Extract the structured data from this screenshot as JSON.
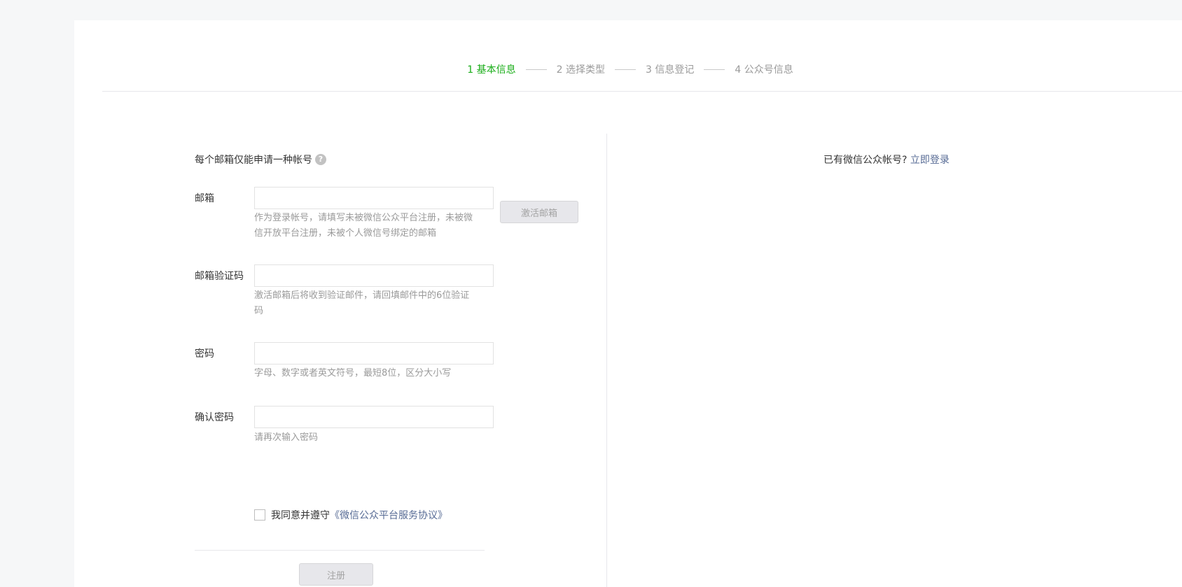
{
  "steps": [
    {
      "label": "1 基本信息"
    },
    {
      "label": "2 选择类型"
    },
    {
      "label": "3 信息登记"
    },
    {
      "label": "4 公众号信息"
    }
  ],
  "form": {
    "tip": "每个邮箱仅能申请一种帐号",
    "email": {
      "label": "邮箱",
      "value": "",
      "placeholder": "",
      "hint": "作为登录帐号，请填写未被微信公众平台注册，未被微信开放平台注册，未被个人微信号绑定的邮箱",
      "activate_label": "激活邮箱"
    },
    "code": {
      "label": "邮箱验证码",
      "value": "",
      "placeholder": "",
      "hint": "激活邮箱后将收到验证邮件，请回填邮件中的6位验证码"
    },
    "password": {
      "label": "密码",
      "value": "",
      "placeholder": "",
      "hint": "字母、数字或者英文符号，最短8位，区分大小写"
    },
    "confirm": {
      "label": "确认密码",
      "value": "",
      "placeholder": "",
      "hint": "请再次输入密码"
    },
    "agree": {
      "checked": false,
      "text": "我同意并遵守",
      "link": "《微信公众平台服务协议》"
    },
    "register_label": "注册"
  },
  "side": {
    "text": "已有微信公众帐号?",
    "link": "立即登录"
  },
  "colors": {
    "active_step": "#1aad19",
    "link": "#576b95",
    "hint": "#9a9a9a"
  }
}
